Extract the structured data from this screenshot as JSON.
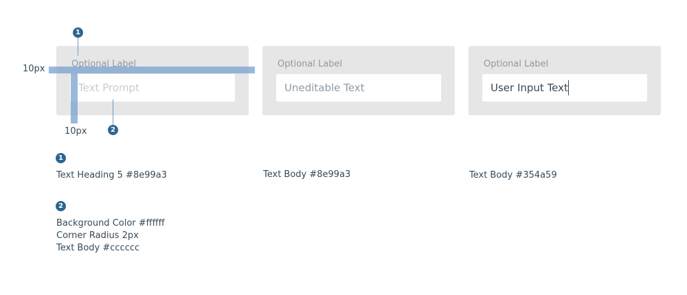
{
  "panels": [
    {
      "label": "Optional Label",
      "field_text": "Text Prompt",
      "field_color": "#cccccc"
    },
    {
      "label": "Optional Label",
      "field_text": "Uneditable Text",
      "field_color": "#8e99a3"
    },
    {
      "label": "Optional Label",
      "field_text": "User Input Text",
      "field_color": "#354a59"
    }
  ],
  "measurements": {
    "horizontal_gap": "10px",
    "vertical_gap": "10px"
  },
  "callouts": {
    "badge_1": "1",
    "badge_2": "2"
  },
  "specs": {
    "note_1": "Text Heading 5 #8e99a3",
    "panel2_note": "Text Body #8e99a3",
    "panel3_note": "Text Body #354a59",
    "note_2_lines": [
      "Background Color #ffffff",
      "Corner Radius 2px",
      "Text Body #cccccc"
    ]
  },
  "colors": {
    "panel_bg": "#e6e6e6",
    "field_bg": "#ffffff",
    "label_color": "#8e99a3",
    "body_dark": "#354a59",
    "placeholder": "#cccccc",
    "badge": "#2c6690",
    "guide": "#78a0d0"
  }
}
